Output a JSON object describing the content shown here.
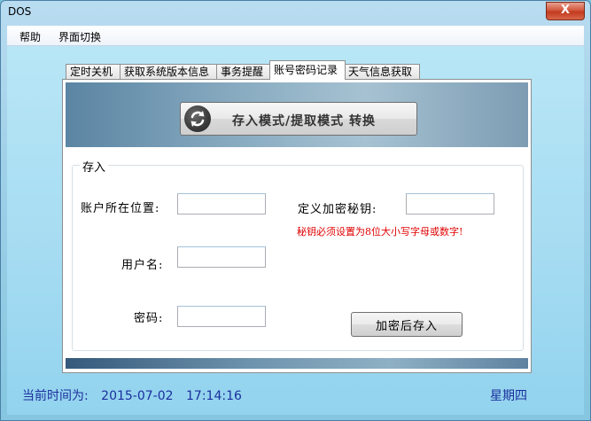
{
  "window": {
    "title": "DOS",
    "close_label": "X"
  },
  "menu": {
    "items": [
      "帮助",
      "界面切换"
    ]
  },
  "tabs": [
    {
      "label": "定时关机"
    },
    {
      "label": "获取系统版本信息"
    },
    {
      "label": "事务提醒"
    },
    {
      "label": "账号密码记录",
      "active": true
    },
    {
      "label": "天气信息获取"
    }
  ],
  "toggle": {
    "label": "存入模式/提取模式 转换",
    "icon": "swap-arrows-icon"
  },
  "group": {
    "title": "存入",
    "account_location_label": "账户所在位置:",
    "account_location_value": "",
    "username_label": "用户名:",
    "username_value": "",
    "password_label": "密码:",
    "password_value": "",
    "key_label": "定义加密秘钥:",
    "key_value": "",
    "key_warning": "秘钥必须设置为8位大小写字母或数字!",
    "save_label": "加密后存入"
  },
  "status": {
    "time_label": "当前时间为:",
    "date": "2015-07-02",
    "time": "17:14:16",
    "weekday": "星期四"
  },
  "colors": {
    "warning": "#e00000",
    "status_text": "#1b2f9e"
  }
}
